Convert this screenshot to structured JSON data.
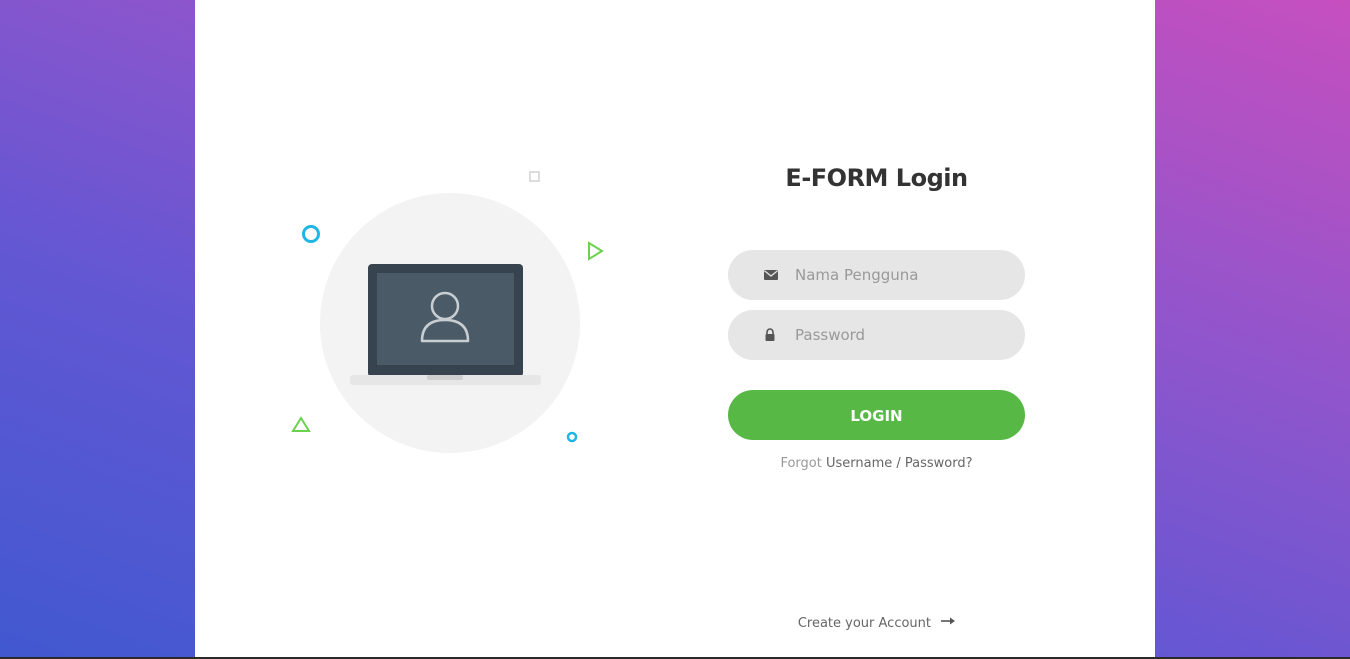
{
  "colors": {
    "accent_green": "#57b846",
    "field_bg": "#e6e6e6",
    "title": "#333333",
    "bg_gradient_start": "#c64fbf",
    "bg_gradient_end": "#4158d0"
  },
  "login_form": {
    "title": "E-FORM Login",
    "username": {
      "icon": "envelope-icon",
      "placeholder": "Nama Pengguna",
      "value": ""
    },
    "password": {
      "icon": "lock-icon",
      "placeholder": "Password",
      "value": ""
    },
    "login_label": "LOGIN",
    "forgot_prefix": "Forgot",
    "forgot_link": "Username / Password?"
  },
  "footer": {
    "create_account": "Create your Account",
    "create_icon": "arrow-right-icon"
  },
  "illustration": {
    "icon": "laptop-user-icon"
  }
}
